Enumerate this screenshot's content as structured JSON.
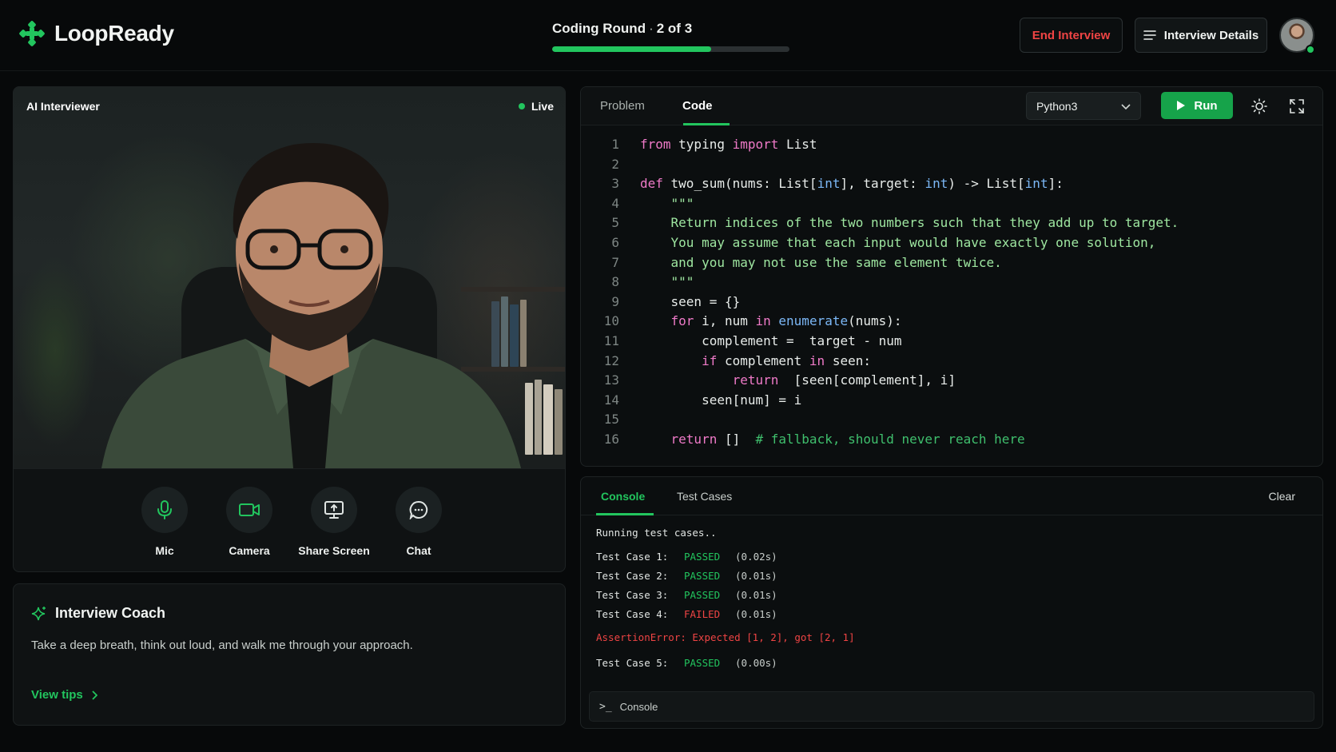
{
  "app": {
    "name": "LoopReady"
  },
  "header": {
    "round_title": "Coding Round",
    "round_separator": "·",
    "round_progress_text": "2 of 3",
    "progress_fraction": 0.67,
    "end_label": "End Interview",
    "details_label": "Interview Details"
  },
  "video": {
    "label": "AI Interviewer",
    "status": "Live",
    "controls": [
      {
        "id": "mic",
        "label": "Mic",
        "icon": "microphone-icon"
      },
      {
        "id": "camera",
        "label": "Camera",
        "icon": "camera-icon"
      },
      {
        "id": "share",
        "label": "Share Screen",
        "icon": "share-screen-icon"
      },
      {
        "id": "chat",
        "label": "Chat",
        "icon": "chat-icon"
      }
    ]
  },
  "coach": {
    "title": "Interview Coach",
    "message": "Take a deep breath, think out loud, and walk me through your approach.",
    "link": "View tips"
  },
  "editor": {
    "tabs": [
      "Problem",
      "Code"
    ],
    "active_tab": "Code",
    "language": "Python3",
    "run_label": "Run",
    "line_numbers": [
      "1",
      "2",
      "3",
      "4",
      "5",
      "6",
      "7",
      "8",
      "9",
      "10",
      "11",
      "12",
      "13",
      "14",
      "15",
      "16"
    ],
    "code": {
      "l1": [
        "from",
        " typing ",
        "import",
        " List"
      ],
      "l3": [
        "def",
        " two_sum(nums: List[",
        "int",
        "], target: ",
        "int",
        ") -> List[",
        "int",
        "]:"
      ],
      "l4": "    \"\"\"",
      "l5": "    Return indices of the two numbers such that they add up to target.",
      "l6": "    You may assume that each input would have exactly one solution,",
      "l7": "    and you may not use the same element twice.",
      "l8": "    \"\"\"",
      "l9": "    seen = {}",
      "l10": [
        "    ",
        "for",
        " i, num ",
        "in",
        " ",
        "enumerate",
        "(nums):"
      ],
      "l11": "        complement =  target - num",
      "l12": [
        "        ",
        "if",
        " complement ",
        "in",
        " seen:"
      ],
      "l13": [
        "            ",
        "return",
        "  [seen[complement], i]"
      ],
      "l14": "        seen[num] = i",
      "l16": [
        "    ",
        "return",
        " []  ",
        "# fallback, should never reach here"
      ]
    }
  },
  "console": {
    "tabs": [
      "Console",
      "Test Cases"
    ],
    "active_tab": "Console",
    "clear_label": "Clear",
    "running_text": "Running test cases..",
    "results": [
      {
        "name": "Test Case 1:",
        "status": "PASSED",
        "time": "(0.02s)"
      },
      {
        "name": "Test Case 2:",
        "status": "PASSED",
        "time": "(0.01s)"
      },
      {
        "name": "Test Case 3:",
        "status": "PASSED",
        "time": "(0.01s)"
      },
      {
        "name": "Test Case 4:",
        "status": "FAILED",
        "time": "(0.01s)"
      }
    ],
    "error": "AssertionError: Expected [1, 2], got [2, 1]",
    "result5": {
      "name": "Test Case 5:",
      "status": "PASSED",
      "time": "(0.00s)"
    },
    "prompt_symbol": ">_",
    "input_label": "Console"
  },
  "colors": {
    "accent": "#22c55e",
    "danger": "#ef4444",
    "background": "#07090a"
  }
}
